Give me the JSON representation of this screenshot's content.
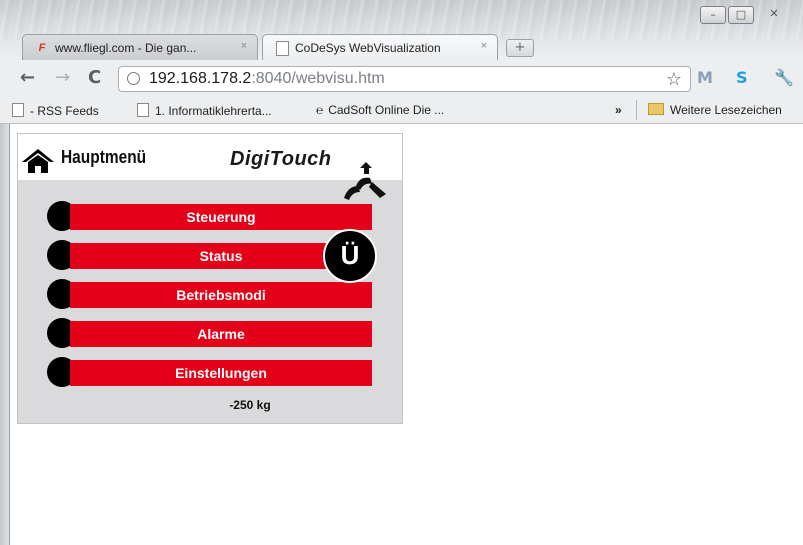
{
  "browser": {
    "tabs": [
      {
        "label": "www.fliegl.com - Die gan...",
        "close": "×",
        "active": false
      },
      {
        "label": "CoDeSys WebVisualization",
        "close": "×",
        "active": true
      }
    ],
    "new_tab_glyph": "+",
    "window_controls": {
      "minimize": "–",
      "maximize": "□",
      "close": "✕"
    },
    "nav": {
      "back": "←",
      "forward": "→",
      "reload": "C"
    },
    "address": {
      "host": "192.168.178.2",
      "rest": ":8040/webvisu.htm"
    },
    "bookmarks": [
      {
        "label": "- RSS Feeds",
        "icon": "page-icon"
      },
      {
        "label": "1. Informatiklehrerta...",
        "icon": "page-icon"
      },
      {
        "label": "CadSoft Online Die ...",
        "icon": "cadsoft-icon"
      }
    ],
    "bookmarks_more": "»",
    "other_bookmarks": "Weitere Lesezeichen"
  },
  "visu": {
    "home_label": "Hauptmenü",
    "logo_text": "DigiTouch",
    "menu_items": [
      {
        "label": "Steuerung"
      },
      {
        "label": "Status"
      },
      {
        "label": "Betriebsmodi"
      },
      {
        "label": "Alarme"
      },
      {
        "label": "Einstellungen"
      }
    ],
    "badge": "Ü",
    "weight": "-250 kg"
  },
  "colors": {
    "menu_red": "#e40018",
    "panel_gray": "#dadadc",
    "indicator": "#000000"
  }
}
